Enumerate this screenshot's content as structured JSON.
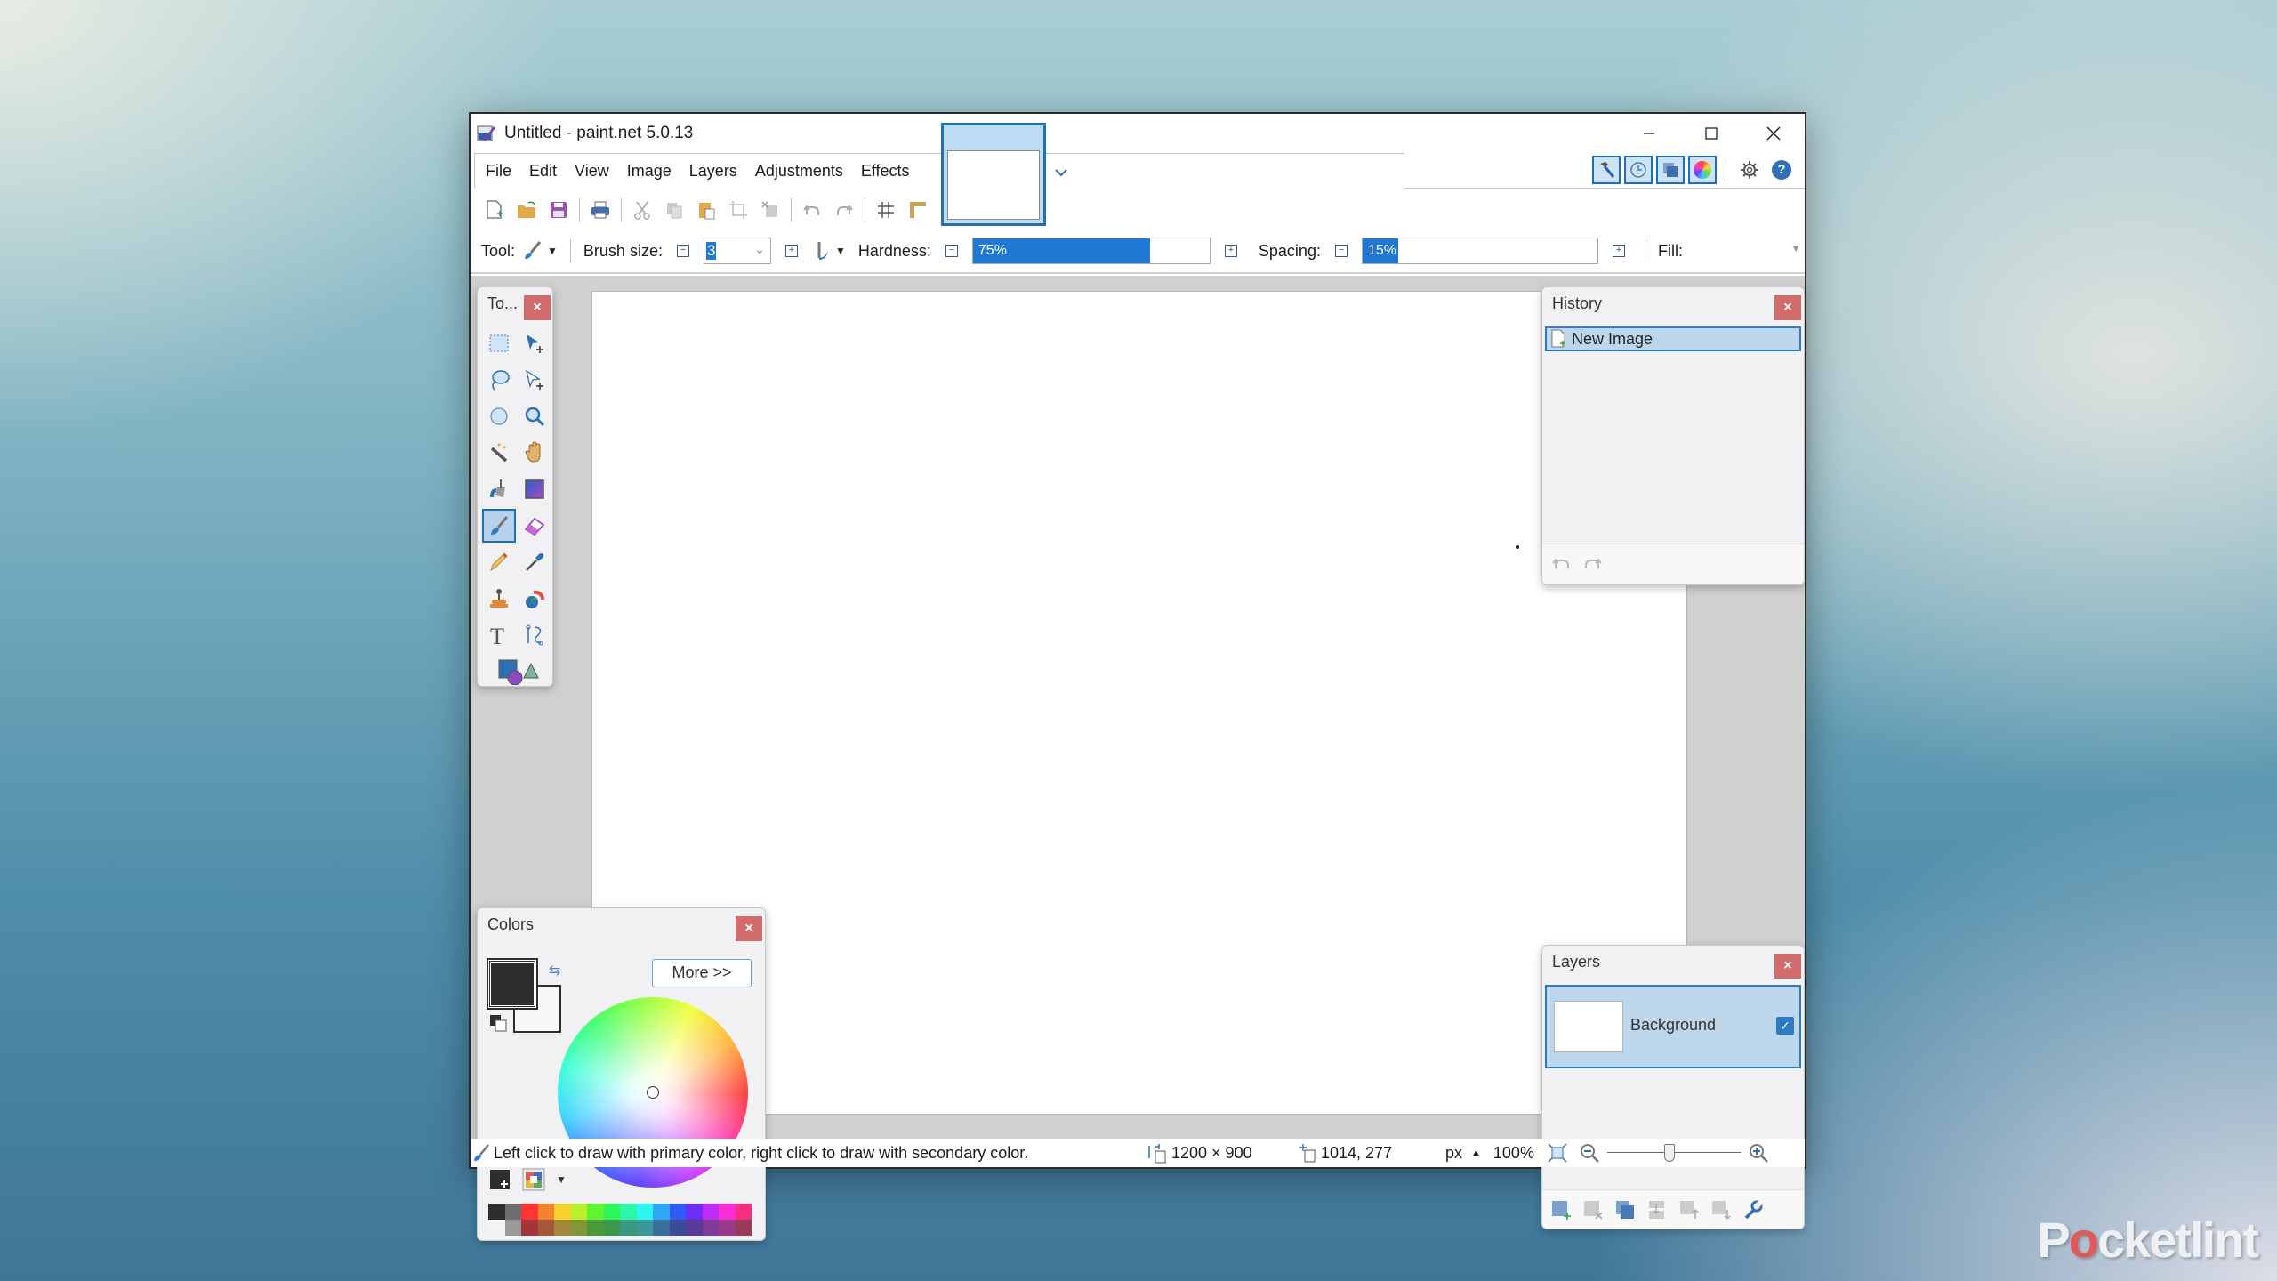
{
  "window": {
    "title": "Untitled - paint.net 5.0.13"
  },
  "menu": [
    "File",
    "Edit",
    "View",
    "Image",
    "Layers",
    "Adjustments",
    "Effects"
  ],
  "image_tabs": [
    {
      "name": "Untitled",
      "active": true
    }
  ],
  "right_tools": {
    "toggles": [
      {
        "name": "tools-window-toggle",
        "icon": "hammer-icon",
        "active": true
      },
      {
        "name": "history-window-toggle",
        "icon": "history-clock-icon",
        "active": true
      },
      {
        "name": "layers-window-toggle",
        "icon": "layers-icon",
        "active": true
      },
      {
        "name": "colors-window-toggle",
        "icon": "color-wheel-icon",
        "active": true
      }
    ],
    "settings_icon": "gear-icon",
    "help_icon": "help-icon"
  },
  "toolbar": {
    "buttons": [
      {
        "name": "new-button",
        "icon": "new-file-icon"
      },
      {
        "name": "open-button",
        "icon": "open-folder-icon"
      },
      {
        "name": "save-button",
        "icon": "save-icon"
      },
      {
        "name": "print-button",
        "icon": "print-icon"
      },
      {
        "name": "cut-button",
        "icon": "cut-icon"
      },
      {
        "name": "copy-button",
        "icon": "copy-icon"
      },
      {
        "name": "paste-button",
        "icon": "paste-icon"
      },
      {
        "name": "crop-button",
        "icon": "crop-icon"
      },
      {
        "name": "deselect-button",
        "icon": "deselect-icon"
      },
      {
        "name": "undo-button",
        "icon": "undo-icon"
      },
      {
        "name": "redo-button",
        "icon": "redo-icon"
      },
      {
        "name": "grid-button",
        "icon": "grid-icon"
      },
      {
        "name": "rulers-button",
        "icon": "ruler-icon"
      }
    ]
  },
  "options": {
    "tool_label": "Tool:",
    "brush_size_label": "Brush size:",
    "brush_size_value": "3",
    "hardness_label": "Hardness:",
    "hardness_value": "75%",
    "hardness_fraction": 0.75,
    "spacing_label": "Spacing:",
    "spacing_value": "15%",
    "spacing_fraction": 0.15,
    "fill_label": "Fill:"
  },
  "tools_panel": {
    "title": "To...",
    "close": "×",
    "tools": [
      {
        "name": "rectangle-select",
        "icon": "rectangle-select-icon"
      },
      {
        "name": "move-selected-pixels",
        "icon": "move-pixels-icon"
      },
      {
        "name": "lasso-select",
        "icon": "lasso-icon"
      },
      {
        "name": "move-selection",
        "icon": "move-selection-icon"
      },
      {
        "name": "ellipse-select",
        "icon": "ellipse-select-icon"
      },
      {
        "name": "zoom",
        "icon": "zoom-icon"
      },
      {
        "name": "magic-wand",
        "icon": "magic-wand-icon"
      },
      {
        "name": "pan",
        "icon": "hand-icon"
      },
      {
        "name": "paint-bucket",
        "icon": "paint-bucket-icon"
      },
      {
        "name": "gradient",
        "icon": "gradient-icon"
      },
      {
        "name": "paintbrush",
        "icon": "paintbrush-icon",
        "active": true
      },
      {
        "name": "eraser",
        "icon": "eraser-icon"
      },
      {
        "name": "pencil",
        "icon": "pencil-icon"
      },
      {
        "name": "color-picker",
        "icon": "color-picker-icon"
      },
      {
        "name": "clone-stamp",
        "icon": "clone-stamp-icon"
      },
      {
        "name": "recolor",
        "icon": "recolor-icon"
      },
      {
        "name": "text",
        "icon": "text-icon"
      },
      {
        "name": "line-curve",
        "icon": "line-curve-icon"
      },
      {
        "name": "shapes",
        "icon": "shapes-icon"
      }
    ]
  },
  "history_panel": {
    "title": "History",
    "close": "×",
    "items": [
      {
        "label": "New Image",
        "selected": true
      }
    ]
  },
  "colors_panel": {
    "title": "Colors",
    "close": "×",
    "more_button": "More >>",
    "primary_color": "#2e2e2e",
    "secondary_color": "#f7f7f7",
    "palette_top": [
      "#2e2e2e",
      "#6e6e6e",
      "#ff3434",
      "#f5802e",
      "#f5d22e",
      "#b9f02e",
      "#5cf52e",
      "#2ef55c",
      "#2ef5a8",
      "#2ef5f0",
      "#2ea8f5",
      "#2e5cf5",
      "#6e2ef5",
      "#c02ef5",
      "#f52ed8",
      "#f52e82"
    ],
    "palette_bottom": [
      "#f3f3f3",
      "#9a9a9a",
      "#a3343a",
      "#a3583a",
      "#a3883a",
      "#80983a",
      "#4c983a",
      "#3a984c",
      "#3a9880",
      "#3a9898",
      "#3a7098",
      "#3a4c98",
      "#5a3a98",
      "#803a98",
      "#983a88",
      "#983a5c"
    ]
  },
  "layers_panel": {
    "title": "Layers",
    "close": "×",
    "layers": [
      {
        "name": "Background",
        "visible": true,
        "selected": true
      }
    ]
  },
  "status": {
    "hint": "Left click to draw with primary color, right click to draw with secondary color.",
    "image_size": "1200 × 900",
    "cursor_position": "1014, 277",
    "units": "px",
    "zoom": "100%"
  },
  "watermark": {
    "prefix": "P",
    "o": "o",
    "suffix": "cketlint"
  }
}
